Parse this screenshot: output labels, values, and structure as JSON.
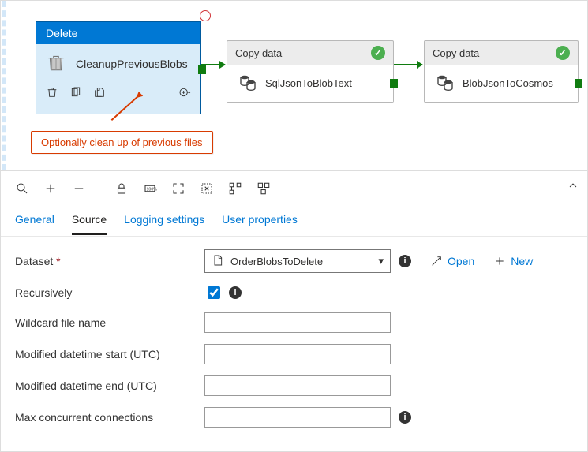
{
  "canvas": {
    "selected": {
      "type": "Delete",
      "name": "CleanupPreviousBlobs"
    },
    "copy1": {
      "type": "Copy data",
      "name": "SqlJsonToBlobText"
    },
    "copy2": {
      "type": "Copy data",
      "name": "BlobJsonToCosmos"
    },
    "annotation": "Optionally clean up of previous files"
  },
  "tabs": {
    "general": "General",
    "source": "Source",
    "logging": "Logging settings",
    "userprops": "User properties"
  },
  "form": {
    "dataset_label": "Dataset",
    "dataset_value": "OrderBlobsToDelete",
    "open": "Open",
    "new": "New",
    "recursively_label": "Recursively",
    "wildcard_label": "Wildcard file name",
    "mod_start_label": "Modified datetime start (UTC)",
    "mod_end_label": "Modified datetime end (UTC)",
    "max_conn_label": "Max concurrent connections"
  }
}
